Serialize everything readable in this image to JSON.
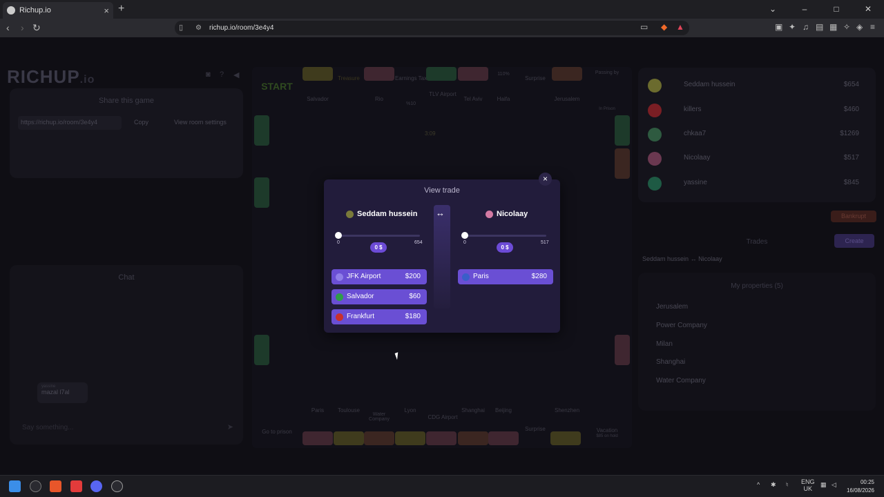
{
  "browser": {
    "tab_title": "Richup.io",
    "url": "richup.io/room/3e4y4"
  },
  "game": {
    "logo": "RICHUP",
    "logo_suffix": ".io",
    "share_title": "Share this game",
    "share_url": "https://richup.io/room/3e4y4",
    "copy_label": "Copy",
    "room_settings_label": "View room settings",
    "chat_title": "Chat",
    "chat_msg_name": "yassine",
    "chat_msg_text": "mazal l7al",
    "chat_placeholder": "Say something...",
    "timer": "3:09",
    "board_cells": {
      "start": "START",
      "salvador": "Salvador",
      "treasure": "Treasure",
      "rio": "Rio",
      "earnings_tax": "Earnings Tax",
      "earnings_pct": "%10",
      "tlv_airport": "TLV Airport",
      "tel_aviv": "Tel Aviv",
      "haifa": "Haifa",
      "surprise": "Surprise",
      "jerusalem": "Jerusalem",
      "passing_by": "Passing by",
      "in_prison": "In Prison",
      "paris": "Paris",
      "toulouse": "Toulouse",
      "water_company": "Water Company",
      "lyon": "Lyon",
      "cdg_airport": "CDG Airport",
      "shanghai": "Shanghai",
      "beijing": "Beijing",
      "shenzhen": "Shenzhen",
      "go_to_prison": "Go to prison",
      "vacation": "Vacation",
      "vacation_sub": "$85 on hold",
      "ten_pct": "110%"
    }
  },
  "players": [
    {
      "name": "Seddam hussein",
      "money": "$654",
      "color": "#6b6b2e"
    },
    {
      "name": "killers",
      "money": "$460",
      "color": "#7a1e24"
    },
    {
      "name": "chkaa7",
      "money": "$1269",
      "color": "#2e5a40"
    },
    {
      "name": "Nicolaay",
      "money": "$517",
      "color": "#6a3850"
    },
    {
      "name": "yassine",
      "money": "$845",
      "color": "#1e5a44"
    }
  ],
  "sidebar": {
    "bankrupt_label": "Bankrupt",
    "trades_title": "Trades",
    "create_label": "Create",
    "trade_from": "Seddam hussein",
    "trade_to": "Nicolaay",
    "my_properties_title": "My properties (5)",
    "my_properties": [
      "Jerusalem",
      "Power Company",
      "Milan",
      "Shanghai",
      "Water Company"
    ]
  },
  "modal": {
    "title": "View trade",
    "left": {
      "name": "Seddam hussein",
      "slider_min": "0",
      "slider_max": "654",
      "amount": "0 $",
      "amount_fraction": 0,
      "properties": [
        {
          "name": "JFK Airport",
          "price": "$200",
          "icon": "plane-icon"
        },
        {
          "name": "Salvador",
          "price": "$60",
          "icon": "brazil-flag-icon"
        },
        {
          "name": "Frankfurt",
          "price": "$180",
          "icon": "germany-flag-icon"
        }
      ]
    },
    "right": {
      "name": "Nicolaay",
      "slider_min": "0",
      "slider_max": "517",
      "amount": "0 $",
      "amount_fraction": 0,
      "properties": [
        {
          "name": "Paris",
          "price": "$280",
          "icon": "france-flag-icon"
        }
      ]
    },
    "swap_glyph": "↔",
    "close_glyph": "×"
  },
  "taskbar": {
    "lang": "ENG",
    "region": "UK",
    "time": "00:25",
    "date": "16/08/2026"
  }
}
